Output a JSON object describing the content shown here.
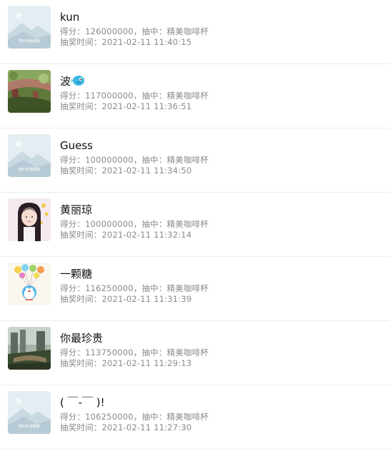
{
  "records": [
    {
      "name": "kun",
      "avatar": "placeholder-avatar-icon",
      "score_label": "得分：",
      "score": "126000000",
      "prize_label": "，抽中：",
      "prize": "精美咖啡杯",
      "time_label": "抽奖时间：",
      "time": "2021-02-11 11:40:15"
    },
    {
      "name": "波",
      "avatar": "bridge-photo-avatar",
      "score_label": "得分：",
      "score": "117000000",
      "prize_label": "，抽中：",
      "prize": "精美咖啡杯",
      "time_label": "抽奖时间：",
      "time": "2021-02-11 11:36:51"
    },
    {
      "name": "Guess",
      "avatar": "placeholder-avatar-icon",
      "score_label": "得分：",
      "score": "100000000",
      "prize_label": "，抽中：",
      "prize": "精美咖啡杯",
      "time_label": "抽奖时间：",
      "time": "2021-02-11 11:34:50"
    },
    {
      "name": "黄丽琼",
      "avatar": "girl-photo-avatar",
      "score_label": "得分：",
      "score": "100000000",
      "prize_label": "，抽中：",
      "prize": "精美咖啡杯",
      "time_label": "抽奖时间：",
      "time": "2021-02-11 11:32:14"
    },
    {
      "name": "一颗糖",
      "avatar": "doraemon-balloons-avatar",
      "score_label": "得分：",
      "score": "116250000",
      "prize_label": "，抽中：",
      "prize": "精美咖啡杯",
      "time_label": "抽奖时间：",
      "time": "2021-02-11 11:31:39"
    },
    {
      "name": "你最珍贵",
      "avatar": "city-photo-avatar",
      "score_label": "得分：",
      "score": "113750000",
      "prize_label": "，抽中：",
      "prize": "精美咖啡杯",
      "time_label": "抽奖时间：",
      "time": "2021-02-11 11:29:13"
    },
    {
      "name": "( ￣-￣ )!",
      "avatar": "placeholder-avatar-icon",
      "score_label": "得分：",
      "score": "106250000",
      "prize_label": "，抽中：",
      "prize": "精美咖啡杯",
      "time_label": "抽奖时间：",
      "time": "2021-02-11 11:27:30"
    }
  ],
  "placeholder_text": "暂时无该图像",
  "colors": {
    "name": "#111111",
    "meta": "#8a8a8a",
    "divider": "#ececec",
    "placeholder_bg": "#dbe7ee"
  }
}
